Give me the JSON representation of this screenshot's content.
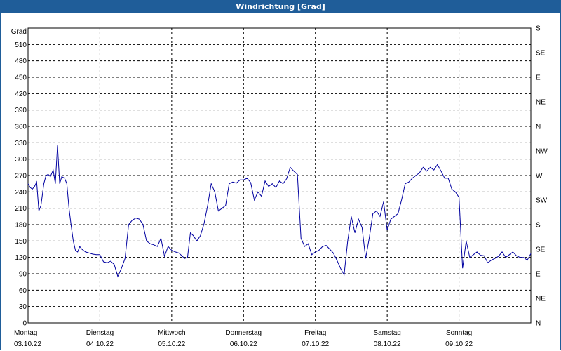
{
  "window": {
    "title": "Windrichtung [Grad]"
  },
  "chart_data": {
    "type": "line",
    "title": "Windrichtung [Grad]",
    "ylabel": "Grad",
    "ylim": [
      0,
      540
    ],
    "y_ticks": [
      0,
      30,
      60,
      90,
      120,
      150,
      180,
      210,
      240,
      270,
      300,
      330,
      360,
      390,
      420,
      450,
      480,
      510
    ],
    "right_axis_labels": [
      "N",
      "NE",
      "E",
      "SE",
      "S",
      "SW",
      "W",
      "NW",
      "N",
      "NE",
      "E",
      "SE",
      "S"
    ],
    "x_labels": [
      {
        "day": "Montag",
        "date": "03.10.22"
      },
      {
        "day": "Dienstag",
        "date": "04.10.22"
      },
      {
        "day": "Mittwoch",
        "date": "05.10.22"
      },
      {
        "day": "Donnerstag",
        "date": "06.10.22"
      },
      {
        "day": "Freitag",
        "date": "07.10.22"
      },
      {
        "day": "Samstag",
        "date": "08.10.22"
      },
      {
        "day": "Sonntag",
        "date": "09.10.22"
      }
    ],
    "xlim_days": [
      0,
      7
    ],
    "grid": true,
    "series": [
      {
        "color": "#0000a0",
        "x": [
          0,
          0.03,
          0.06,
          0.09,
          0.12,
          0.15,
          0.18,
          0.22,
          0.25,
          0.28,
          0.31,
          0.35,
          0.38,
          0.41,
          0.44,
          0.47,
          0.51,
          0.54,
          0.57,
          0.6,
          0.63,
          0.66,
          0.69,
          0.72,
          0.75,
          0.8,
          0.85,
          0.9,
          0.95,
          1.0,
          1.05,
          1.1,
          1.15,
          1.2,
          1.25,
          1.3,
          1.35,
          1.4,
          1.45,
          1.5,
          1.55,
          1.6,
          1.65,
          1.7,
          1.75,
          1.8,
          1.85,
          1.9,
          1.95,
          2.0,
          2.05,
          2.1,
          2.15,
          2.18,
          2.22,
          2.26,
          2.3,
          2.35,
          2.4,
          2.45,
          2.5,
          2.55,
          2.6,
          2.65,
          2.7,
          2.75,
          2.8,
          2.85,
          2.9,
          2.95,
          3.0,
          3.05,
          3.1,
          3.15,
          3.2,
          3.25,
          3.3,
          3.35,
          3.4,
          3.45,
          3.5,
          3.55,
          3.6,
          3.65,
          3.7,
          3.75,
          3.8,
          3.85,
          3.9,
          3.95,
          4.0,
          4.05,
          4.1,
          4.15,
          4.2,
          4.25,
          4.3,
          4.35,
          4.4,
          4.45,
          4.5,
          4.55,
          4.6,
          4.65,
          4.7,
          4.75,
          4.8,
          4.85,
          4.9,
          4.95,
          5.0,
          5.05,
          5.1,
          5.15,
          5.2,
          5.25,
          5.3,
          5.35,
          5.4,
          5.45,
          5.5,
          5.55,
          5.6,
          5.65,
          5.7,
          5.75,
          5.8,
          5.85,
          5.9,
          5.95,
          6.0,
          6.05,
          6.1,
          6.15,
          6.2,
          6.25,
          6.3,
          6.35,
          6.4,
          6.45,
          6.5,
          6.55,
          6.6,
          6.65,
          6.7,
          6.75,
          6.8,
          6.85,
          6.9,
          6.95,
          7.0
        ],
        "y": [
          255,
          248,
          245,
          250,
          258,
          205,
          215,
          255,
          270,
          272,
          268,
          280,
          255,
          325,
          255,
          268,
          265,
          255,
          210,
          178,
          150,
          133,
          130,
          140,
          135,
          130,
          128,
          126,
          125,
          125,
          112,
          110,
          113,
          107,
          85,
          100,
          118,
          180,
          188,
          192,
          190,
          180,
          150,
          145,
          143,
          140,
          155,
          122,
          140,
          133,
          130,
          128,
          122,
          118,
          120,
          165,
          160,
          150,
          160,
          182,
          215,
          255,
          240,
          205,
          210,
          215,
          255,
          258,
          256,
          262,
          262,
          265,
          257,
          225,
          240,
          232,
          260,
          250,
          255,
          248,
          260,
          255,
          264,
          285,
          278,
          272,
          155,
          140,
          145,
          125,
          130,
          133,
          140,
          142,
          135,
          128,
          115,
          100,
          88,
          150,
          195,
          165,
          190,
          175,
          118,
          155,
          200,
          205,
          195,
          222,
          170,
          190,
          195,
          200,
          225,
          255,
          258,
          265,
          270,
          275,
          285,
          278,
          285,
          280,
          290,
          278,
          265,
          265,
          245,
          240,
          230,
          100,
          150,
          120,
          125,
          130,
          124,
          123,
          110,
          115,
          118,
          122,
          130,
          120,
          125,
          130,
          123,
          120,
          120,
          115,
          127
        ]
      }
    ]
  }
}
